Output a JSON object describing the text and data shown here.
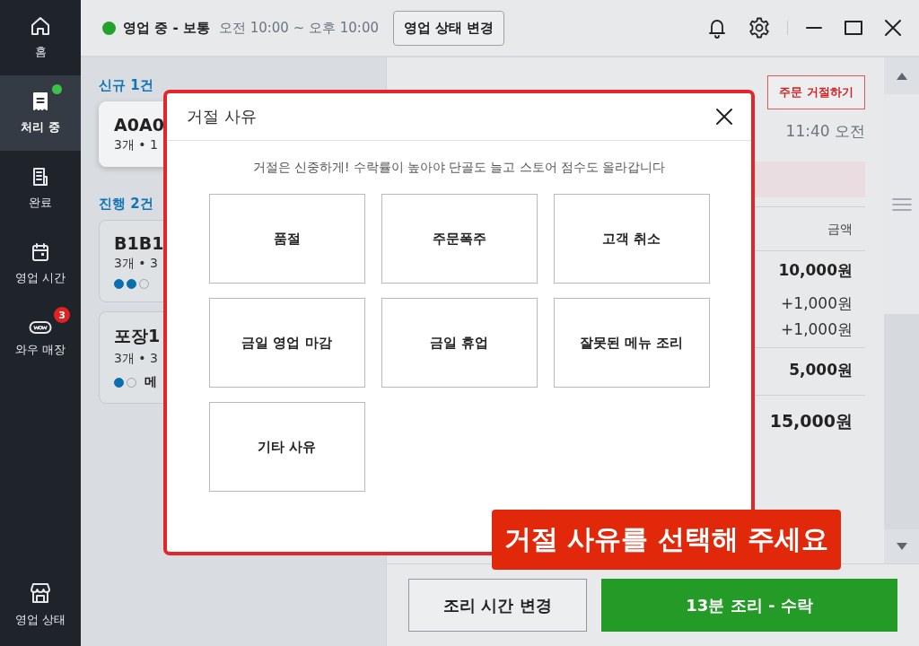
{
  "top_bar": {
    "status": "영업 중 - 보통",
    "hours": "오전 10:00 ~ 오후 10:00",
    "change_button": "영업 상태 변경"
  },
  "sidebar": {
    "items": [
      {
        "label": "홈",
        "selected": false,
        "has_new": false
      },
      {
        "label": "처리 중",
        "selected": true,
        "has_new": true
      },
      {
        "label": "완료",
        "selected": false,
        "has_new": false
      },
      {
        "label": "영업 시간",
        "selected": false,
        "has_new": false
      },
      {
        "label": "와우 매장",
        "selected": false,
        "has_new": false,
        "badge": "3"
      }
    ],
    "footer": {
      "label": "영업 상태"
    }
  },
  "order_list": {
    "sections": [
      {
        "title": "신규 1건",
        "orders": [
          {
            "name": "A0A0",
            "summary": "3개 • 1",
            "selected": true
          }
        ]
      },
      {
        "title": "진행 2건",
        "orders": [
          {
            "name": "B1B1",
            "summary": "3개 • 3",
            "selected": false,
            "steps": [
              {
                "done": true
              },
              {
                "done": true
              },
              {
                "done": false
              }
            ]
          },
          {
            "name": "포장1",
            "summary": "3개 • 3",
            "selected": false,
            "steps": [
              {
                "done": true
              },
              {
                "done": false
              }
            ],
            "status": "메"
          }
        ]
      }
    ]
  },
  "order_detail": {
    "reject_button": "주문 거절하기",
    "time": "11:40 오전",
    "amount_header": "금액",
    "amounts": [
      {
        "text": "10,000원",
        "kind": "price"
      },
      {
        "text": "+1,000원",
        "kind": "option"
      },
      {
        "text": "+1,000원",
        "kind": "option"
      },
      {
        "text": "5,000원",
        "kind": "price"
      },
      {
        "text": "15,000원",
        "kind": "total"
      }
    ]
  },
  "footer": {
    "change_time_button": "조리 시간 변경",
    "accept_button": "13분 조리 - 수락"
  },
  "reject_dialog": {
    "title": "거절 사유",
    "notice": "거절은 신중하게! 수락률이 높아야 단골도 늘고 스토어 점수도 올라갑니다",
    "reasons": [
      {
        "label": "품절",
        "selected": false
      },
      {
        "label": "주문폭주",
        "selected": false
      },
      {
        "label": "고객 취소",
        "selected": false
      },
      {
        "label": "금일 영업 마감",
        "selected": false
      },
      {
        "label": "금일 휴업",
        "selected": false
      },
      {
        "label": "잘못된 메뉴 조리",
        "selected": false
      },
      {
        "label": "기타 사유",
        "selected": false
      }
    ]
  },
  "callout": "거절 사유를 선택해 주세요"
}
